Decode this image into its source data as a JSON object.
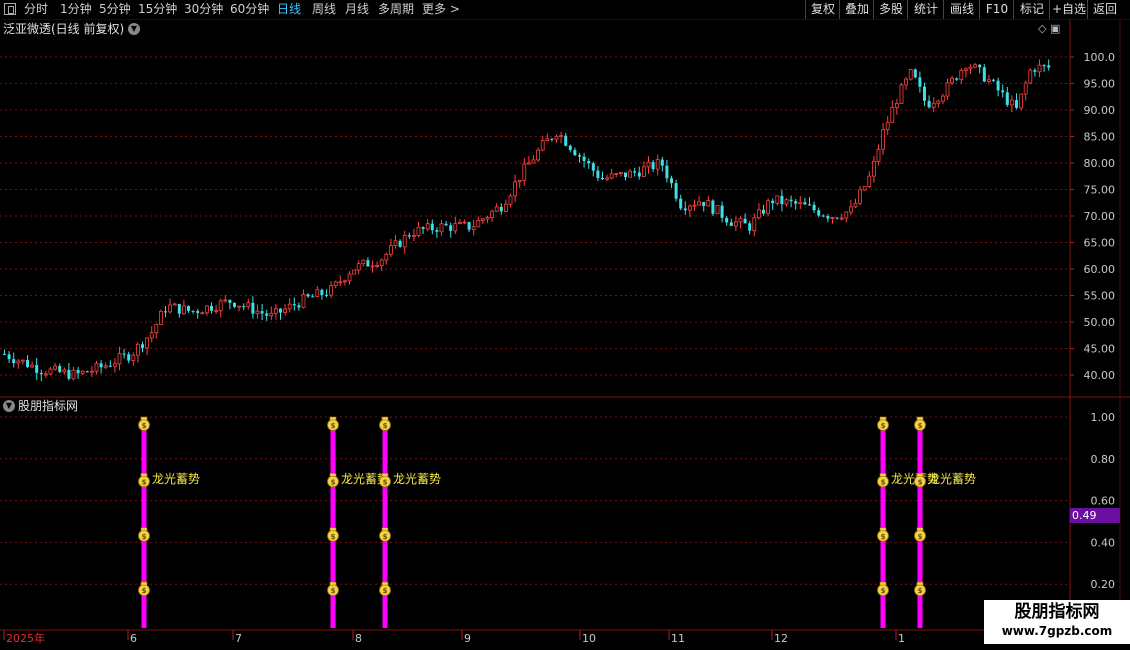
{
  "toolbar": {
    "left_items": [
      "分时",
      "1分钟",
      "5分钟",
      "15分钟",
      "30分钟",
      "60分钟",
      "日线",
      "周线",
      "月线",
      "多周期",
      "更多 >"
    ],
    "active": "日线",
    "right_items": [
      "复权",
      "叠加",
      "多股",
      "统计",
      "画线",
      "F10",
      "标记",
      "+自选",
      "返回"
    ]
  },
  "main_title": "泛亚微透(日线 前复权)",
  "indicator_title": "股朋指标网",
  "price_axis": [
    "100.0",
    "95.00",
    "90.00",
    "85.00",
    "80.00",
    "75.00",
    "70.00",
    "65.00",
    "60.00",
    "55.00",
    "50.00",
    "45.00",
    "40.00"
  ],
  "ind_axis": [
    "1.00",
    "0.80",
    "0.60",
    "0.40",
    "0.20"
  ],
  "ind_value_label": "0.49",
  "date_axis": [
    "2025年",
    "6",
    "7",
    "8",
    "9",
    "10",
    "11",
    "12",
    "1"
  ],
  "signal_label": "龙光蓄势",
  "watermark": {
    "title": "股朋指标网",
    "url": "www.7gpzb.com"
  },
  "colors": {
    "up": "#ff4040",
    "down": "#3ee0e8",
    "signal": "#ff00ff",
    "grid": "#7a1010"
  }
}
